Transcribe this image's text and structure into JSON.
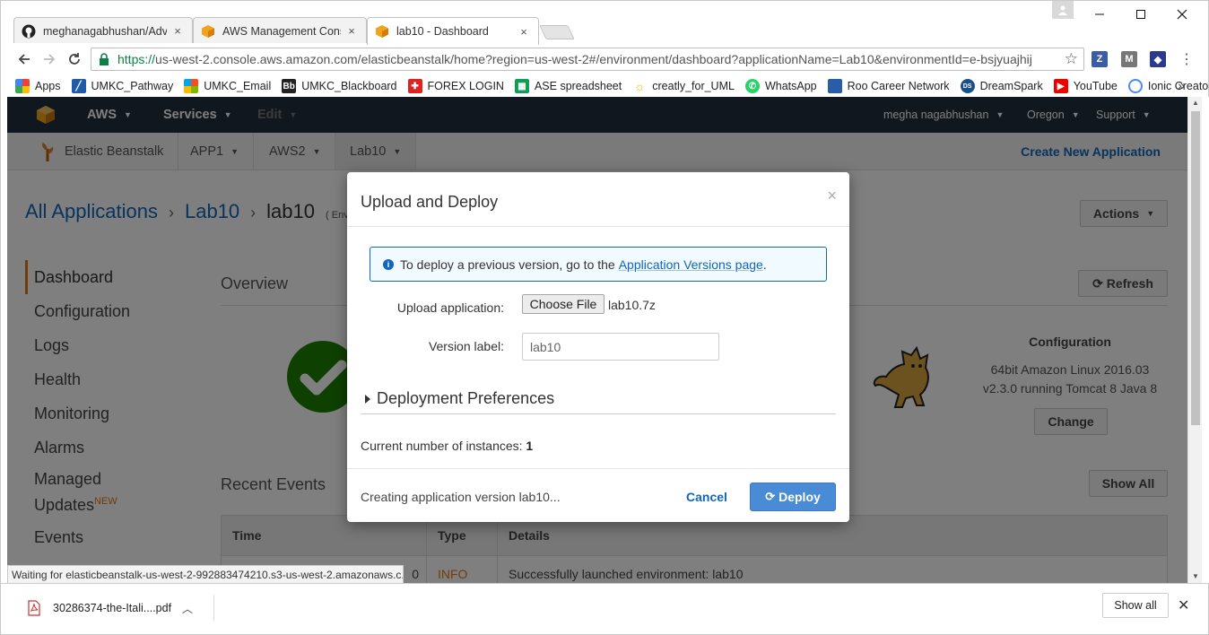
{
  "browser": {
    "tabs": [
      {
        "title": "meghanagabhushan/Adv",
        "close": "×"
      },
      {
        "title": "AWS Management Cons",
        "close": "×"
      },
      {
        "title": "lab10 - Dashboard",
        "close": "×"
      }
    ],
    "url_secure": "https://",
    "url_rest": "us-west-2.console.aws.amazon.com/elasticbeanstalk/home?region=us-west-2#/environment/dashboard?applicationName=Lab10&environmentId=e-bsjyuajhij",
    "bookmarks": [
      "Apps",
      "UMKC_Pathway",
      "UMKC_Email",
      "UMKC_Blackboard",
      "FOREX LOGIN",
      "ASE spreadsheet",
      "creatly_for_UML",
      "WhatsApp",
      "Roo Career Network",
      "DreamSpark",
      "YouTube",
      "Ionic Creator"
    ],
    "bookmarks_more": "»",
    "status_bubble": "Waiting for elasticbeanstalk-us-west-2-992883474210.s3-us-west-2.amazonaws.c..."
  },
  "aws_nav": {
    "aws": "AWS",
    "services": "Services",
    "edit": "Edit",
    "user": "megha nagabhushan",
    "region": "Oregon",
    "support": "Support"
  },
  "app_nav": {
    "service": "Elastic Beanstalk",
    "apps": [
      "APP1",
      "AWS2",
      "Lab10"
    ],
    "create": "Create New Application"
  },
  "breadcrumb": {
    "all": "All Applications",
    "app": "Lab10",
    "env": "lab10",
    "env_suffix": "( Env"
  },
  "actions_label": "Actions",
  "sidebar": {
    "items": [
      "Dashboard",
      "Configuration",
      "Logs",
      "Health",
      "Monitoring",
      "Alarms"
    ],
    "managed_line1": "Managed",
    "managed_line2": "Updates",
    "new_badge": "NEW",
    "events": "Events"
  },
  "overview": {
    "title": "Overview",
    "refresh": "Refresh",
    "config_title": "Configuration",
    "config_line1": "64bit Amazon Linux 2016.03",
    "config_line2": "v2.3.0 running Tomcat 8 Java 8",
    "change": "Change"
  },
  "events": {
    "title": "Recent Events",
    "show_all": "Show All",
    "columns": [
      "Time",
      "Type",
      "Details"
    ],
    "row": {
      "time": "0",
      "type": "INFO",
      "details": "Successfully launched environment: lab10"
    }
  },
  "modal": {
    "title": "Upload and Deploy",
    "close": "×",
    "info_prefix": "To deploy a previous version, go to the",
    "info_link": "Application Versions page",
    "info_suffix": ".",
    "upload_label": "Upload application:",
    "choose_file": "Choose File",
    "file_name": "lab10.7z",
    "version_label": "Version label:",
    "version_value": "lab10",
    "deploy_prefs": "Deployment Preferences",
    "instances_label": "Current number of instances:",
    "instances_value": "1",
    "status": "Creating application version lab10...",
    "cancel": "Cancel",
    "deploy": "Deploy"
  },
  "downloads": {
    "file": "30286374-the-Itali....pdf",
    "show_all": "Show all"
  },
  "colors": {
    "aws_nav_bg": "#232f3e",
    "accent_orange": "#e47911",
    "link_blue": "#1166bb",
    "deploy_blue": "#4a8bd6",
    "ok_green": "#1d8102"
  }
}
